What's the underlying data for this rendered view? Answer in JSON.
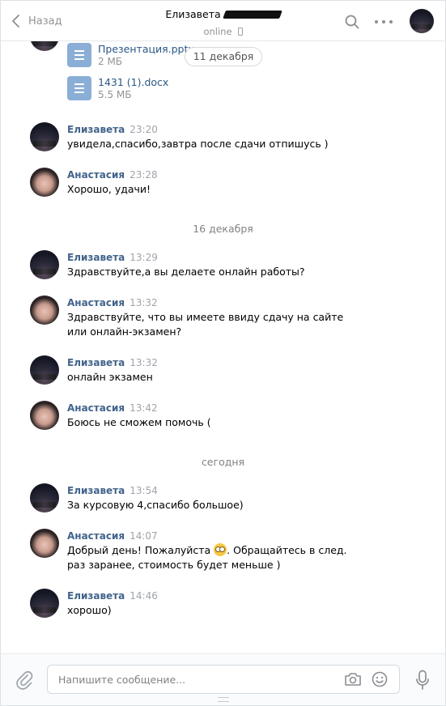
{
  "header": {
    "back_label": "Назад",
    "contact_name": "Елизавета",
    "status": "online"
  },
  "attachments": [
    {
      "name": "Презентация.pptx",
      "size": "2 МБ",
      "icon": "document-icon"
    },
    {
      "name": "1431 (1).docx",
      "size": "5.5 МБ",
      "icon": "document-icon"
    }
  ],
  "floating_date": "11 декабря",
  "dates": [
    "16 декабря",
    "сегодня"
  ],
  "messages": [
    {
      "author": "Елизавета",
      "time": "23:20",
      "text": "увидела,спасибо,завтра после сдачи отпишусь )"
    },
    {
      "author": "Анастасия",
      "time": "23:28",
      "text": "Хорошо, удачи!"
    },
    {
      "author": "Елизавета",
      "time": "13:29",
      "text": "Здравствуйте,а вы делаете онлайн работы?"
    },
    {
      "author": "Анастасия",
      "time": "13:32",
      "text": "Здравствуйте, что вы имеете ввиду сдачу на сайте или онлайн-экзамен?"
    },
    {
      "author": "Елизавета",
      "time": "13:32",
      "text": "онлайн экзамен"
    },
    {
      "author": "Анастасия",
      "time": "13:42",
      "text": "Боюсь не сможем помочь ("
    },
    {
      "author": "Елизавета",
      "time": "13:54",
      "text": "За курсовую 4,спасибо большое)"
    },
    {
      "author": "Анастасия",
      "time": "14:07",
      "text_before_emoji": "Добрый день! Пожалуйста",
      "emoji": "flushed-face-emoji",
      "text_after_emoji": ". Обращайтесь в след. раз заранее, стоимость будет меньше )"
    },
    {
      "author": "Елизавета",
      "time": "14:46",
      "text": "хорошо)"
    }
  ],
  "composer": {
    "placeholder": "Напишите сообщение..."
  },
  "colors": {
    "author": "#42648b",
    "link": "#2a5885",
    "muted": "#939393",
    "doc_icon": "#8aaed6"
  }
}
